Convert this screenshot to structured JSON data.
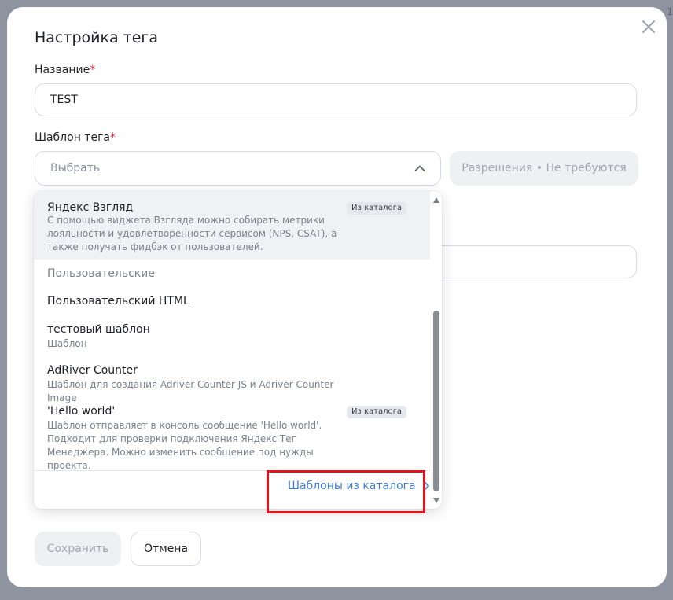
{
  "modal": {
    "title": "Настройка тега",
    "name_label": "Название",
    "required_mark": "*",
    "name_value": "TEST",
    "template_label": "Шаблон тега",
    "template_placeholder": "Выбрать",
    "permissions_label": "Разрешения • Не требуются",
    "save_label": "Сохранить",
    "cancel_label": "Отмена"
  },
  "dropdown": {
    "items": [
      {
        "name": "Яндекс Взгляд",
        "badge": "Из каталога",
        "description": "С помощью виджета Взгляда можно собирать метрики лояльности и удовлетворенности сервисом (NPS, CSAT), а также получать фидбэк от пользователей."
      },
      {
        "group": "Пользовательские"
      },
      {
        "name": "Пользовательский HTML"
      },
      {
        "name": "тестовый шаблон",
        "description": "Шаблон"
      },
      {
        "name": "AdRiver Counter",
        "description": "Шаблон для создания Adriver Counter JS и Adriver Counter Image"
      },
      {
        "name": "'Hello world'",
        "badge": "Из каталога",
        "description": "Шаблон отправляет в консоль сообщение 'Hello world'. Подходит для проверки подключения Яндекс Тег Менеджера. Можно изменить сообщение под нужды проекта."
      }
    ],
    "catalog_link": "Шаблоны из каталога"
  },
  "colors": {
    "accent_link": "#3f7fd8",
    "required": "#e0262f",
    "annotation_box": "#e0161d"
  },
  "icons": {
    "close": "close-icon",
    "select_toggle": "chevron-up-icon",
    "catalog_arrow": "chevron-right-icon"
  }
}
